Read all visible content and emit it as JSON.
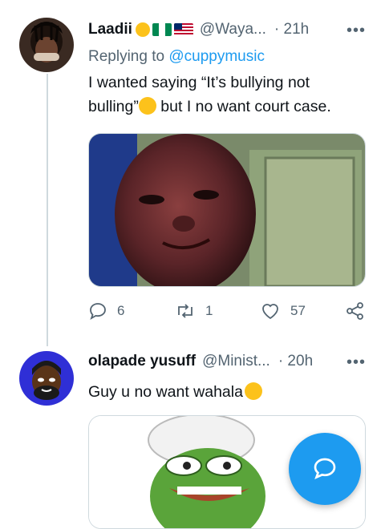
{
  "tweets": [
    {
      "name": "Laadii",
      "handle": "@Waya...",
      "time": "· 21h",
      "more": "•••",
      "reply_label": "Replying to",
      "reply_handle": "@cuppymusic",
      "text_line1": "I wanted saying “It’s bullying not",
      "text_line2a": "bulling”",
      "text_line2b": " but I no want court case.",
      "stats": {
        "replies": "6",
        "retweets": "1",
        "likes": "57"
      }
    },
    {
      "name": "olapade yusuff",
      "handle": "@Minist...",
      "time": "· 20h",
      "more": "•••",
      "text": "Guy u no want wahala"
    }
  ],
  "icons": {
    "reply": "reply-icon",
    "retweet": "retweet-icon",
    "like": "heart-icon",
    "share": "share-icon",
    "compose": "compose-reply-icon"
  },
  "colors": {
    "accent": "#1d9bf0",
    "muted": "#536471",
    "line": "#cfd9de"
  }
}
